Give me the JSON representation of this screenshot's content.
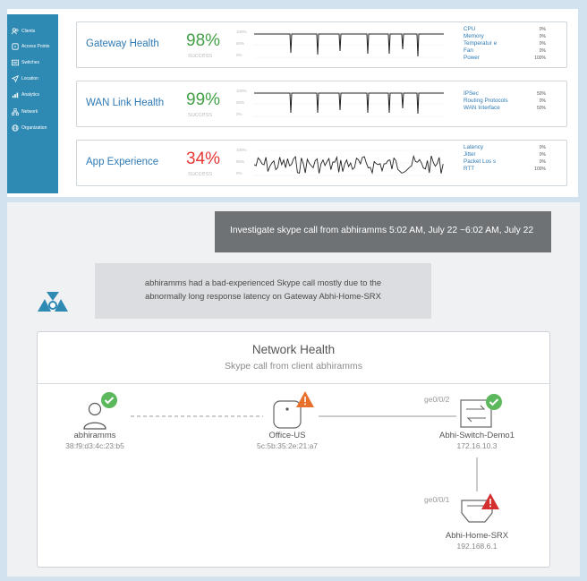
{
  "sidebar": {
    "items": [
      {
        "label": "Clients",
        "icon": "clients-icon"
      },
      {
        "label": "Access Points",
        "icon": "access-point-icon"
      },
      {
        "label": "Switches",
        "icon": "switch-icon"
      },
      {
        "label": "Location",
        "icon": "location-icon"
      },
      {
        "label": "Analytics",
        "icon": "analytics-icon"
      },
      {
        "label": "Network",
        "icon": "network-icon"
      },
      {
        "label": "Organization",
        "icon": "organization-icon"
      }
    ]
  },
  "health_cards": [
    {
      "title": "Gateway Health",
      "percent": "98%",
      "status": "good",
      "sub": "success",
      "yticks": [
        "100%",
        "50%",
        "0%"
      ],
      "metrics": [
        {
          "label": "CPU",
          "value": "0%"
        },
        {
          "label": "Memory",
          "value": "0%"
        },
        {
          "label": "Temperatur e",
          "value": "0%"
        },
        {
          "label": "Fan",
          "value": "0%"
        },
        {
          "label": "Power",
          "value": "100%"
        }
      ]
    },
    {
      "title": "WAN Link Health",
      "percent": "99%",
      "status": "good",
      "sub": "success",
      "yticks": [
        "100%",
        "50%",
        "0%"
      ],
      "metrics": [
        {
          "label": "IPSec",
          "value": "50%"
        },
        {
          "label": "Routing Protocols",
          "value": "0%"
        },
        {
          "label": "WAN Interface",
          "value": "50%"
        }
      ]
    },
    {
      "title": "App Experience",
      "percent": "34%",
      "status": "bad",
      "sub": "success",
      "yticks": [
        "100%",
        "50%",
        "0%"
      ],
      "metrics": [
        {
          "label": "Latency",
          "value": "0%"
        },
        {
          "label": "Jitter",
          "value": "0%"
        },
        {
          "label": "Packet Los s",
          "value": "0%"
        },
        {
          "label": "RTT",
          "value": "100%"
        }
      ]
    }
  ],
  "chat": {
    "user_message": "Investigate skype call from abhiramms 5:02 AM, July 22 ~6:02 AM, July 22",
    "bot_line1": "abhiramms had a bad-experienced Skype call mostly due to the",
    "bot_line2": "abnormally long response latency on Gateway Abhi-Home-SRX"
  },
  "network_health": {
    "title": "Network Health",
    "subtitle": "Skype call from client abhiramms",
    "client": {
      "name": "abhiramms",
      "mac": "38:f9:d3:4c:23:b5",
      "status": "ok"
    },
    "ap": {
      "name": "Office-US",
      "mac": "5c:5b:35:2e:21:a7",
      "status": "warning"
    },
    "switch": {
      "name": "Abhi-Switch-Demo1",
      "ip": "172.16.10.3",
      "port": "ge0/0/2",
      "status": "ok"
    },
    "gateway": {
      "name": "Abhi-Home-SRX",
      "ip": "192.168.6.1",
      "port": "ge0/0/1",
      "status": "error"
    }
  },
  "colors": {
    "ok": "#5cb85c",
    "warning": "#e8702a",
    "error": "#d32f2f",
    "accent": "#2e7ab5",
    "sidebar": "#2f8ab3"
  }
}
